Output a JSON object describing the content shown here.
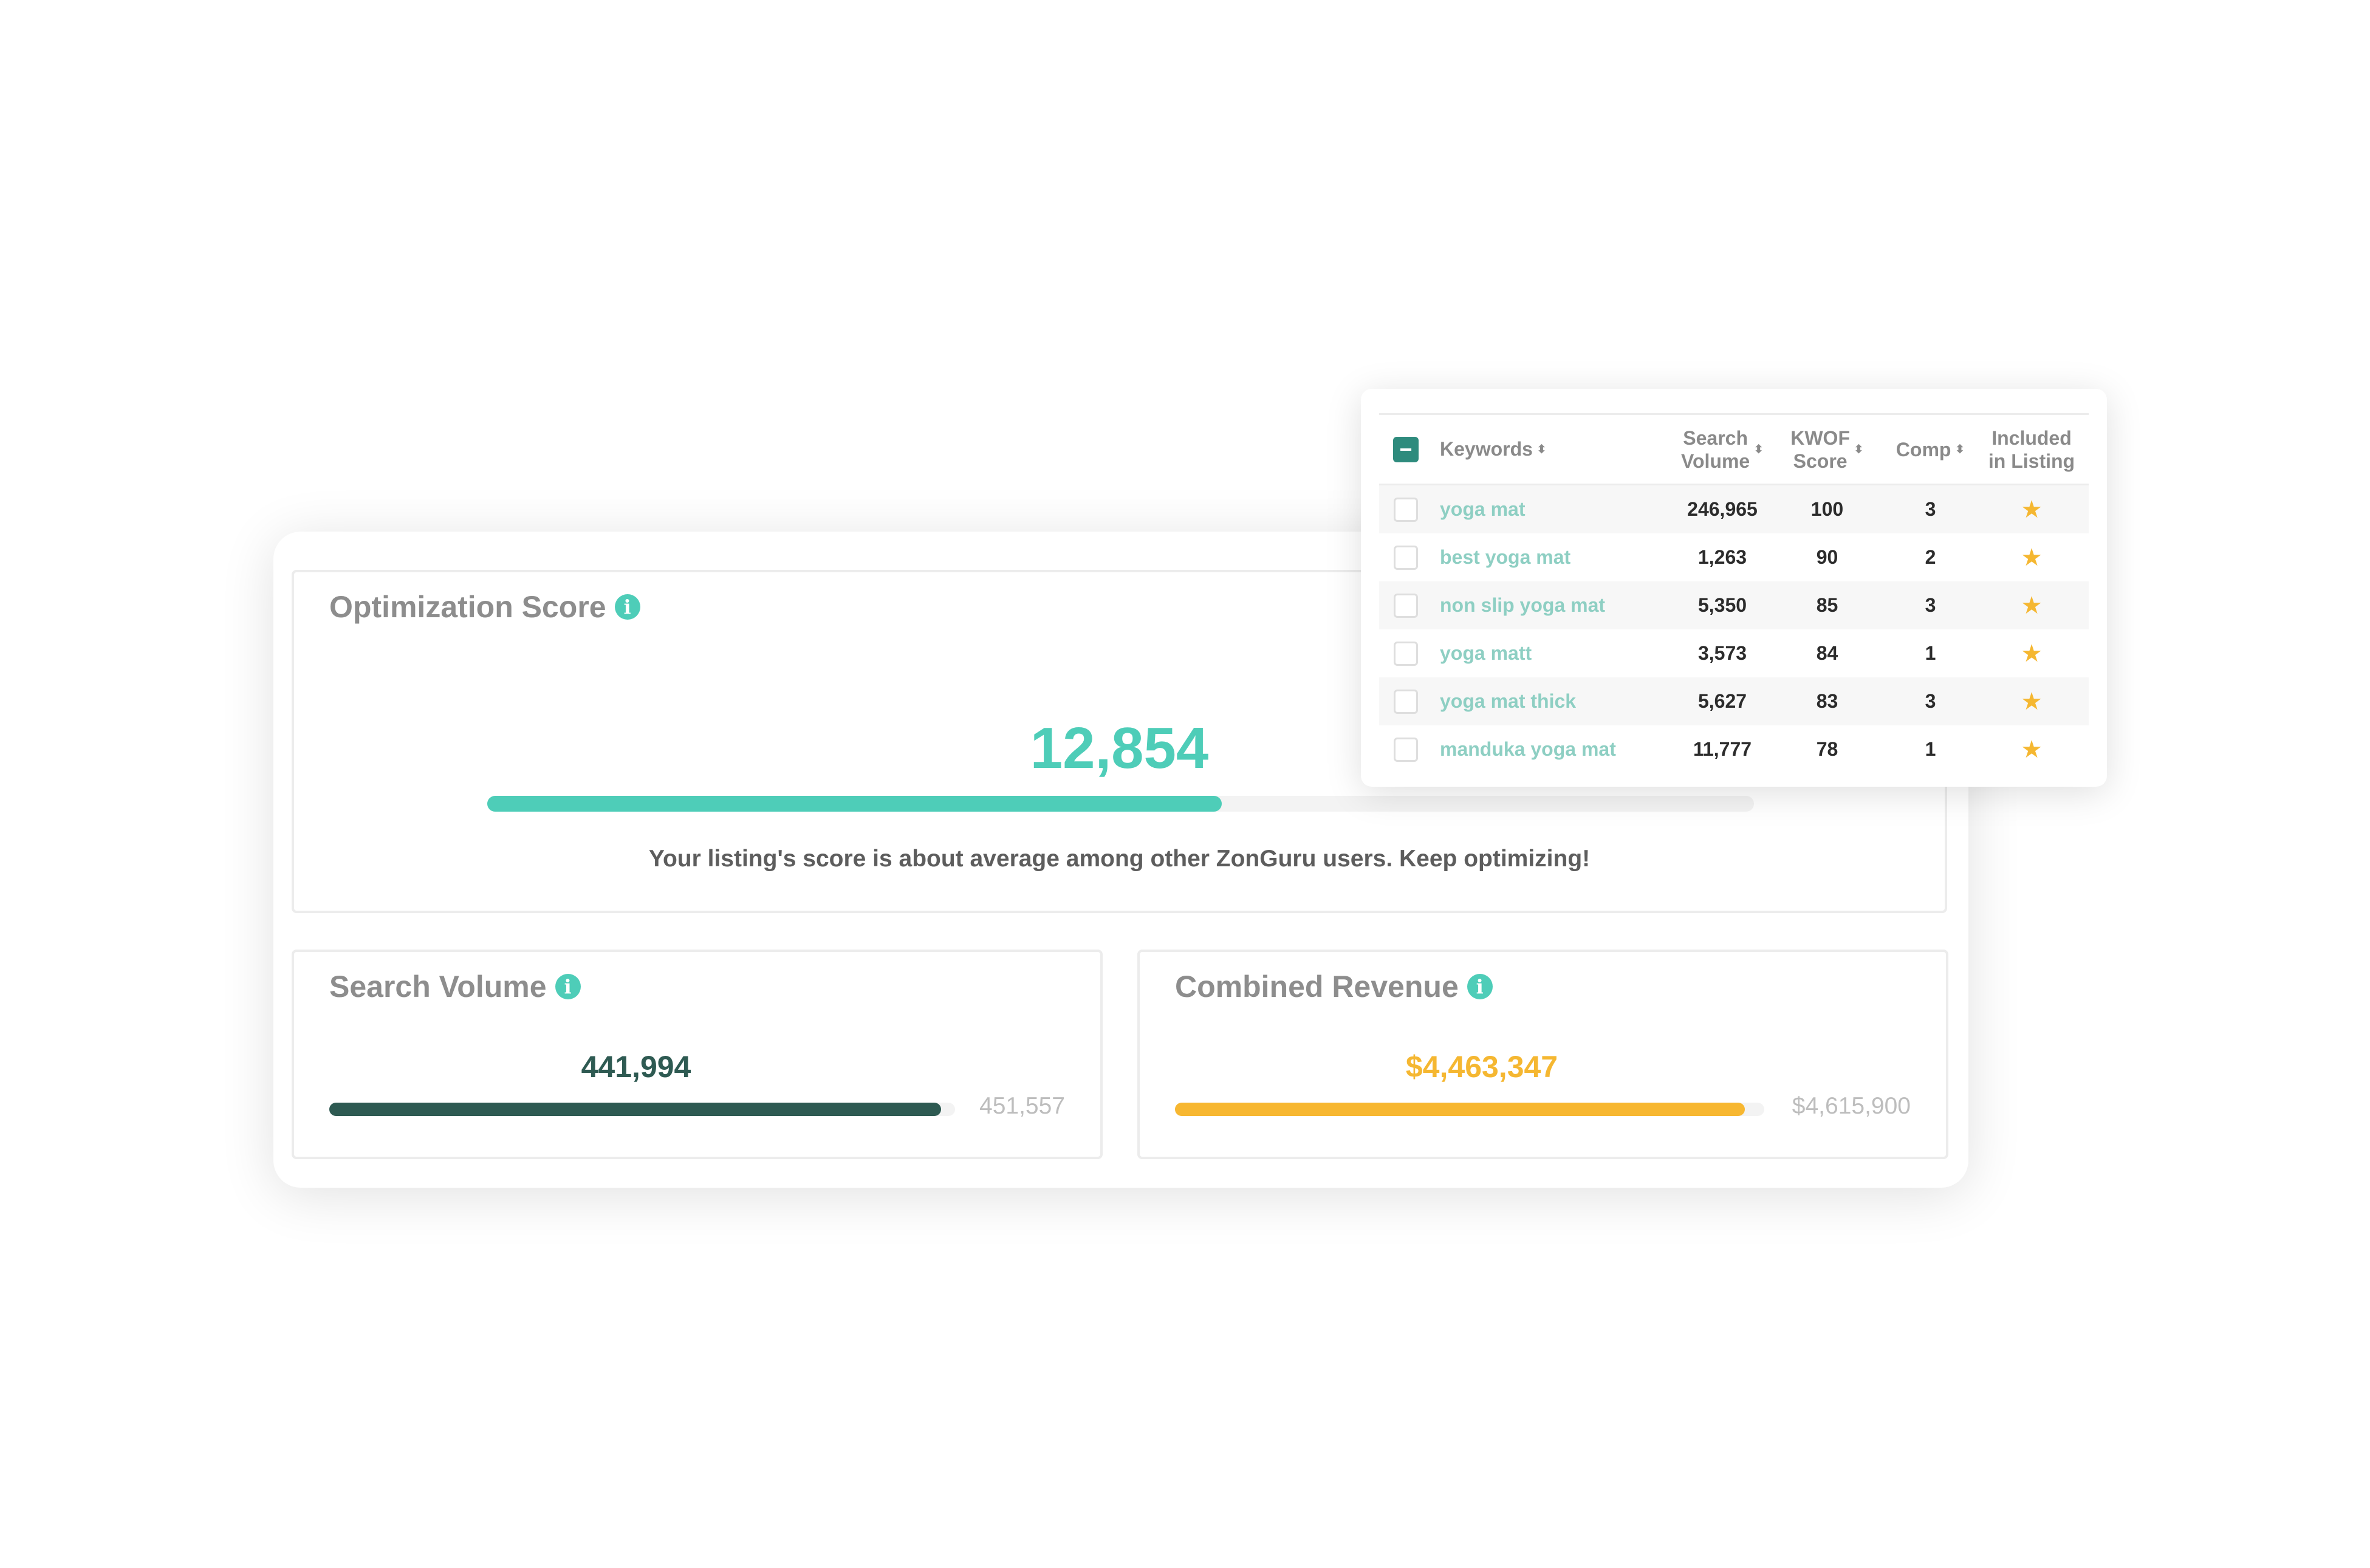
{
  "optimization": {
    "title": "Optimization Score",
    "info_icon": "info-icon",
    "score": "12,854",
    "progress": 0.58,
    "message": "Your listing's score is about average among other ZonGuru users. Keep optimizing!"
  },
  "search_volume": {
    "title": "Search Volume",
    "value": "441,994",
    "max": "451,557",
    "progress": 0.978,
    "color": "#2e5a52"
  },
  "combined_revenue": {
    "title": "Combined Revenue",
    "value": "$4,463,347",
    "max": "$4,615,900",
    "progress": 0.967,
    "color": "#f7b731"
  },
  "keywords_table": {
    "headers": {
      "keywords": "Keywords",
      "search_volume_1": "Search",
      "search_volume_2": "Volume",
      "kwof_1": "KWOF",
      "kwof_2": "Score",
      "comp": "Comp",
      "included_1": "Included",
      "included_2": "in Listing"
    },
    "sort_icon": "sort-icon",
    "rows": [
      {
        "keyword": "yoga mat",
        "search_volume": "246,965",
        "kwof": "100",
        "comp": "3"
      },
      {
        "keyword": "best yoga mat",
        "search_volume": "1,263",
        "kwof": "90",
        "comp": "2"
      },
      {
        "keyword": "non slip yoga mat",
        "search_volume": "5,350",
        "kwof": "85",
        "comp": "3"
      },
      {
        "keyword": "yoga matt",
        "search_volume": "3,573",
        "kwof": "84",
        "comp": "1"
      },
      {
        "keyword": "yoga mat thick",
        "search_volume": "5,627",
        "kwof": "83",
        "comp": "3"
      },
      {
        "keyword": "manduka yoga mat",
        "search_volume": "11,777",
        "kwof": "78",
        "comp": "1"
      }
    ]
  },
  "colors": {
    "accent": "#4ecdb8",
    "dark_green": "#2e5a52",
    "gold": "#f7b731",
    "keyword_link": "#8ecfc3"
  }
}
